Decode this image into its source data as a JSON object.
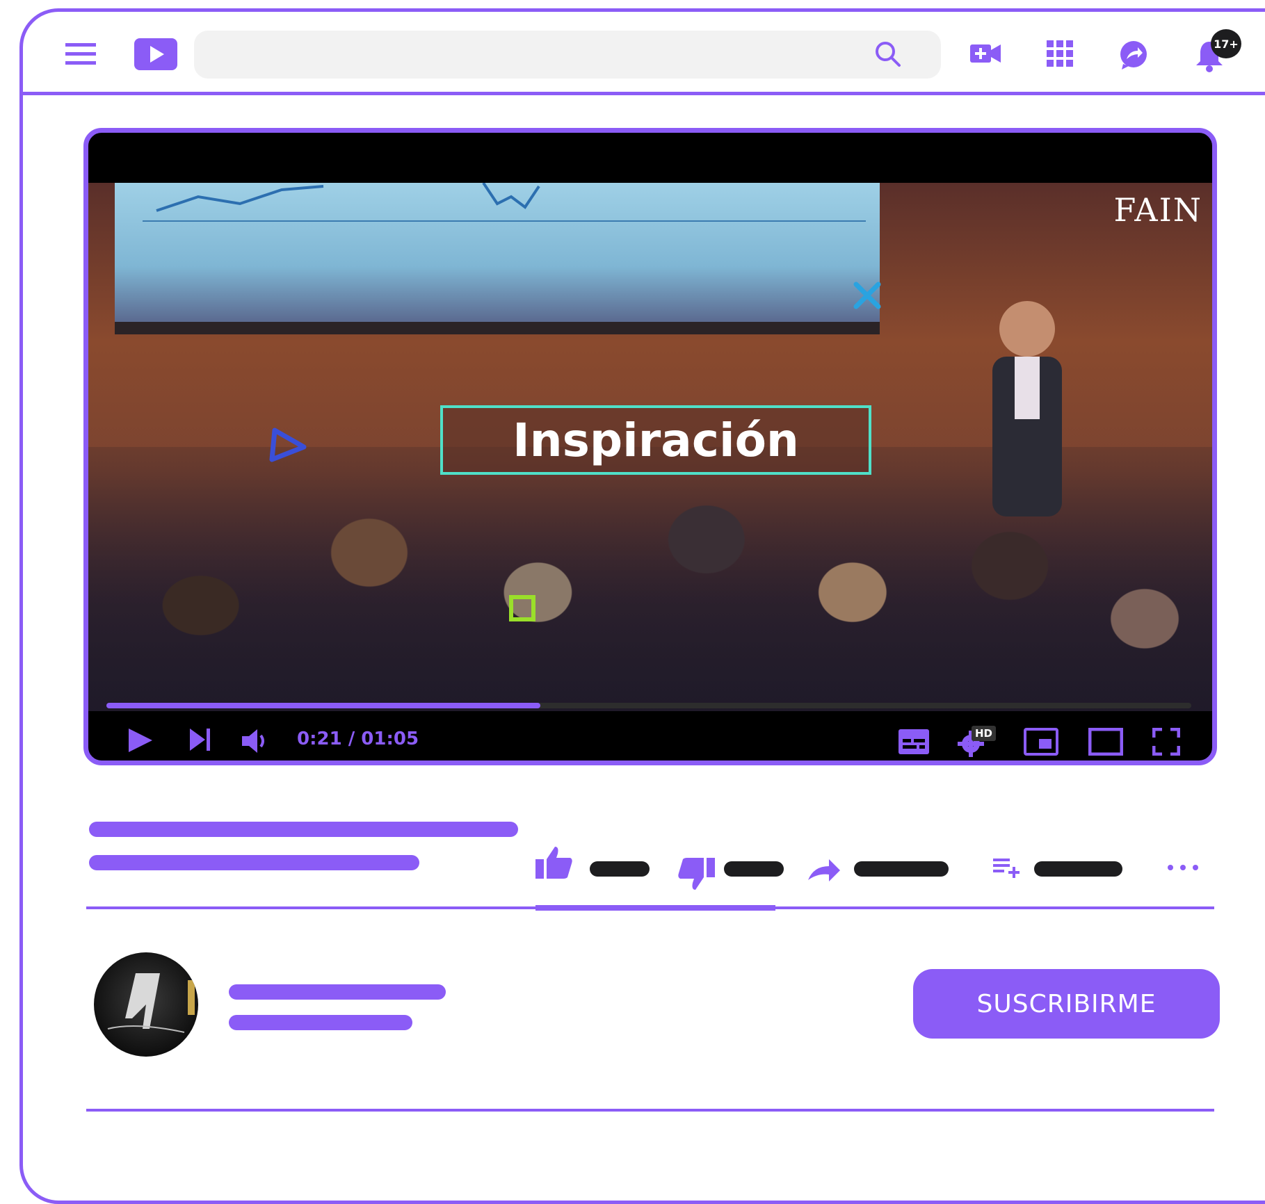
{
  "header": {
    "search": {
      "placeholder": "",
      "value": ""
    },
    "notifications_badge": "17+"
  },
  "player": {
    "overlay_caption": "Inspiración",
    "channel_logo_text": "FAIN",
    "time_display": "0:21 / 01:05",
    "progress_fraction": 0.4,
    "quality_badge": "HD"
  },
  "channel": {
    "subscribe_label": "SUSCRIBIRME"
  },
  "colors": {
    "accent": "#8b5cf6",
    "dark": "#1d1d1f",
    "caption_border": "#4fe0c8"
  },
  "icons": [
    "menu-icon",
    "logo-play-icon",
    "search-icon",
    "create-video-icon",
    "apps-grid-icon",
    "messages-icon",
    "bell-icon",
    "play-icon",
    "next-icon",
    "volume-icon",
    "subtitles-icon",
    "settings-icon",
    "miniplayer-icon",
    "theater-icon",
    "fullscreen-icon",
    "like-icon",
    "dislike-icon",
    "share-icon",
    "save-playlist-icon",
    "more-icon"
  ]
}
